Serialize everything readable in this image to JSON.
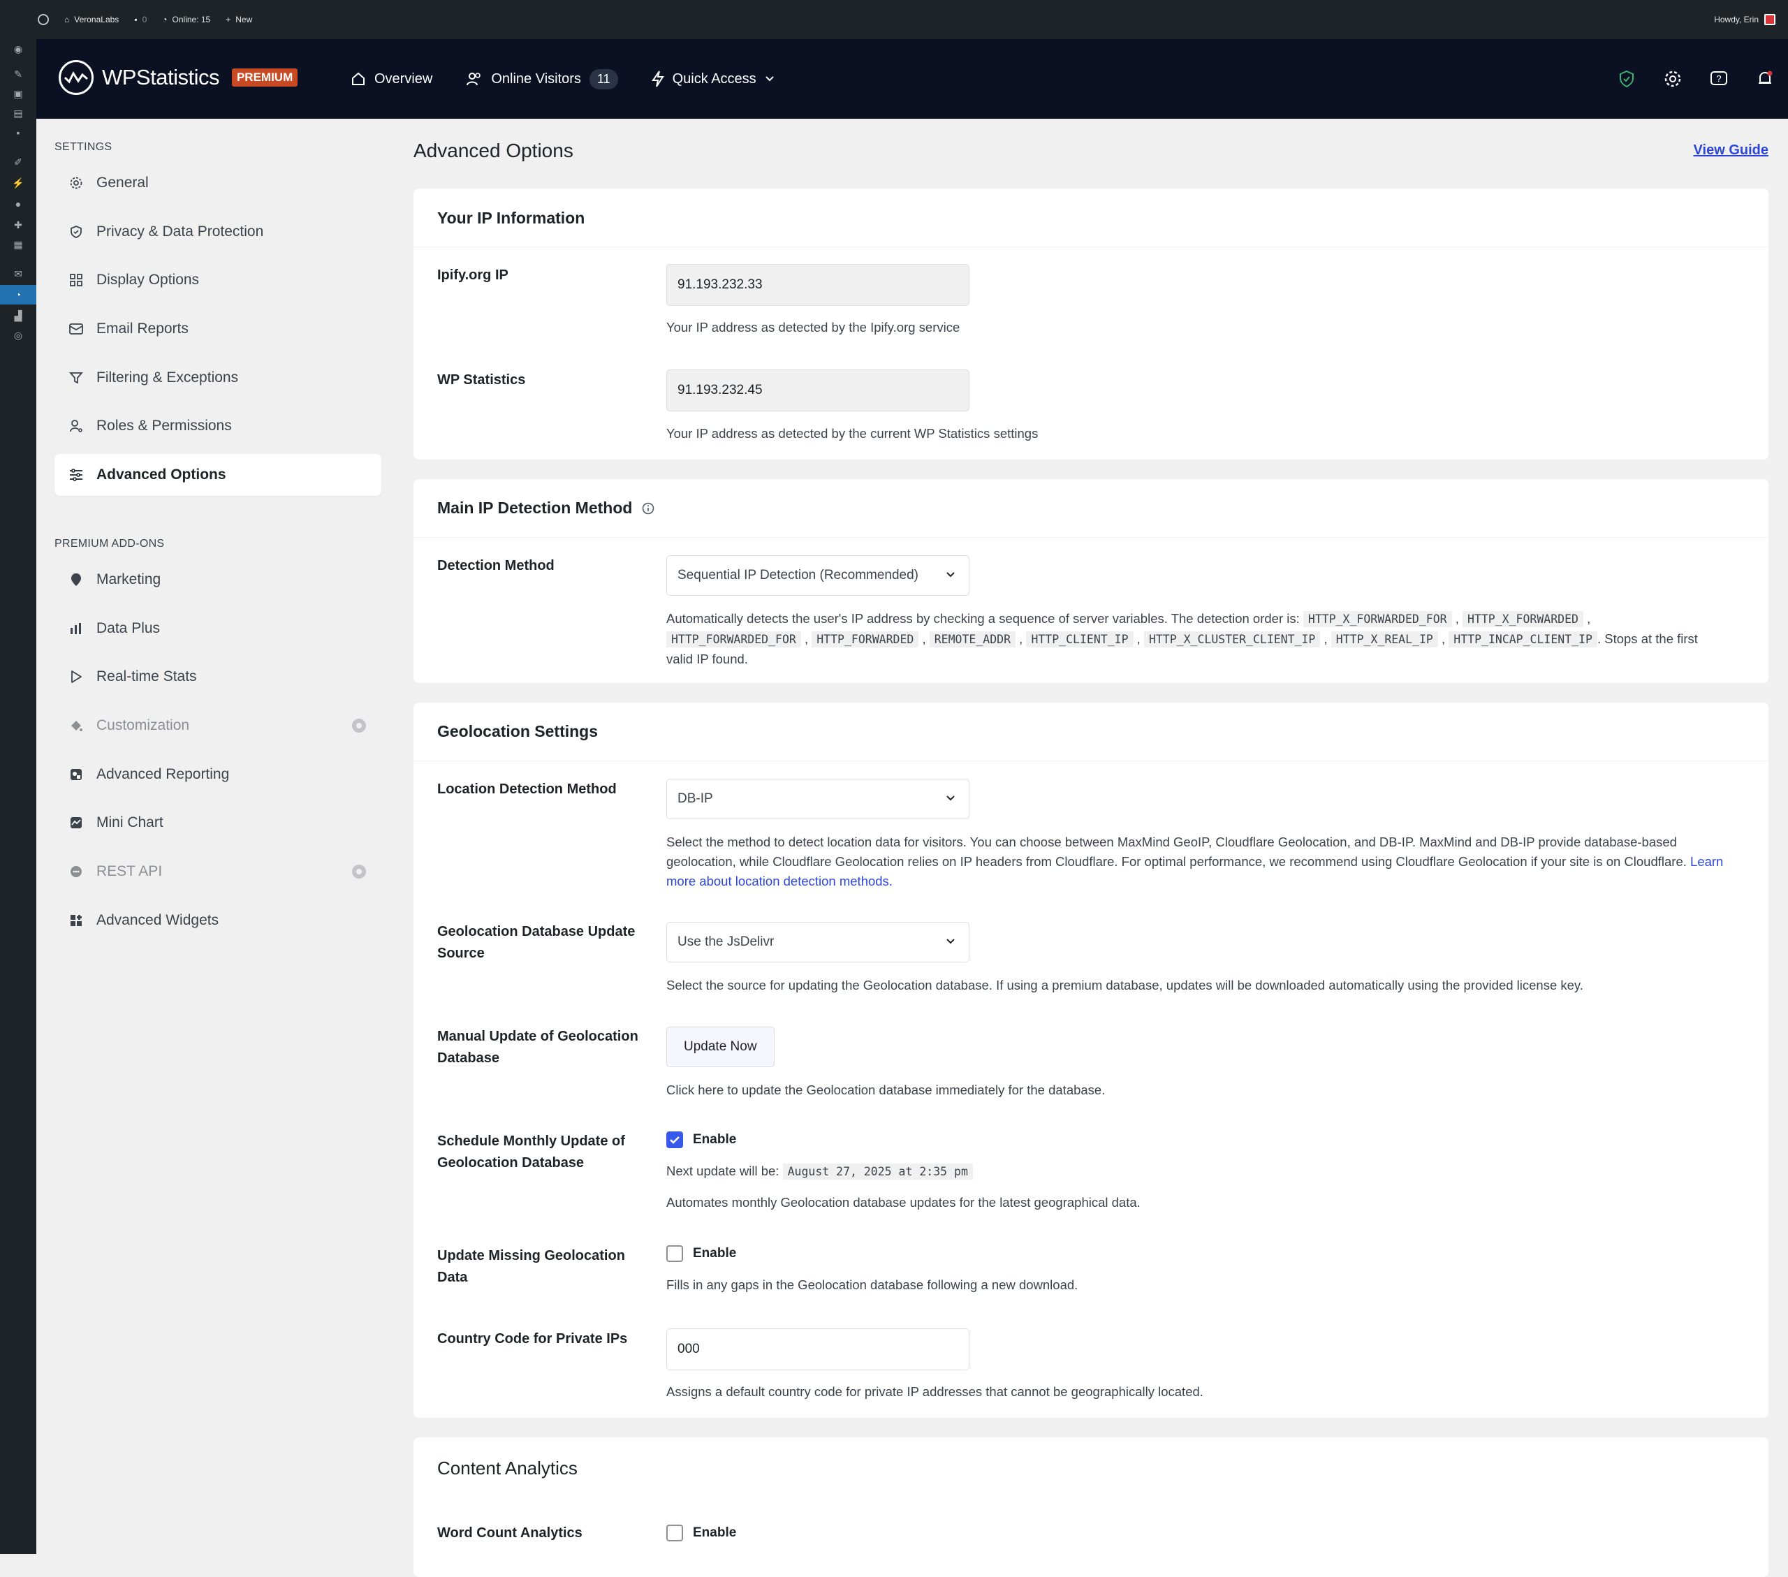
{
  "adminbar": {
    "site_name": "VeronaLabs",
    "comments_count": "0",
    "online": "Online: 15",
    "new": "New",
    "howdy": "Howdy, Erin"
  },
  "header": {
    "logo_text": "WPStatistics",
    "premium_badge": "PREMIUM",
    "nav": {
      "overview": "Overview",
      "online_visitors": "Online Visitors",
      "online_visitors_count": "11",
      "quick_access": "Quick Access"
    }
  },
  "sidebar": {
    "settings_heading": "SETTINGS",
    "settings_items": [
      {
        "label": "General"
      },
      {
        "label": "Privacy & Data Protection"
      },
      {
        "label": "Display Options"
      },
      {
        "label": "Email Reports"
      },
      {
        "label": "Filtering & Exceptions"
      },
      {
        "label": "Roles & Permissions"
      },
      {
        "label": "Advanced Options"
      }
    ],
    "addons_heading": "PREMIUM ADD-ONS",
    "addon_items": [
      {
        "label": "Marketing"
      },
      {
        "label": "Data Plus"
      },
      {
        "label": "Real-time Stats"
      },
      {
        "label": "Customization"
      },
      {
        "label": "Advanced Reporting"
      },
      {
        "label": "Mini Chart"
      },
      {
        "label": "REST API"
      },
      {
        "label": "Advanced Widgets"
      }
    ]
  },
  "page": {
    "title": "Advanced Options",
    "view_guide": "View Guide"
  },
  "ip_info": {
    "title": "Your IP Information",
    "ipify_label": "Ipify.org IP",
    "ipify_value": "91.193.232.33",
    "ipify_desc": "Your IP address as detected by the Ipify.org service",
    "wps_label": "WP Statistics",
    "wps_value": "91.193.232.45",
    "wps_desc": "Your IP address as detected by the current WP Statistics settings"
  },
  "ip_detection": {
    "title": "Main IP Detection Method",
    "method_label": "Detection Method",
    "method_value": "Sequential IP Detection (Recommended)",
    "desc_intro": "Automatically detects the user's IP address by checking a sequence of server variables. The detection order is:",
    "vars": [
      "HTTP_X_FORWARDED_FOR",
      "HTTP_X_FORWARDED",
      "HTTP_FORWARDED_FOR",
      "HTTP_FORWARDED",
      "REMOTE_ADDR",
      "HTTP_CLIENT_IP",
      "HTTP_X_CLUSTER_CLIENT_IP",
      "HTTP_X_REAL_IP",
      "HTTP_INCAP_CLIENT_IP"
    ],
    "desc_outro": ". Stops at the first valid IP found."
  },
  "geolocation": {
    "title": "Geolocation Settings",
    "location_label": "Location Detection Method",
    "location_value": "DB-IP",
    "location_desc": "Select the method to detect location data for visitors. You can choose between MaxMind GeoIP, Cloudflare Geolocation, and DB-IP. MaxMind and DB-IP provide database-based geolocation, while Cloudflare Geolocation relies on IP headers from Cloudflare. For optimal performance, we recommend using Cloudflare Geolocation if your site is on Cloudflare.",
    "location_link": "Learn more about location detection methods.",
    "source_label": "Geolocation Database Update Source",
    "source_value": "Use the JsDelivr",
    "source_desc": "Select the source for updating the Geolocation database. If using a premium database, updates will be downloaded automatically using the provided license key.",
    "manual_label": "Manual Update of Geolocation Database",
    "manual_button": "Update Now",
    "manual_desc": "Click here to update the Geolocation database immediately for the database.",
    "schedule_label": "Schedule Monthly Update of Geolocation Database",
    "schedule_enable": "Enable",
    "schedule_checked": true,
    "next_update_label": "Next update will be:",
    "next_update_value": "August 27, 2025 at 2:35 pm",
    "schedule_desc": "Automates monthly Geolocation database updates for the latest geographical data.",
    "missing_label": "Update Missing Geolocation Data",
    "missing_enable": "Enable",
    "missing_checked": false,
    "missing_desc": "Fills in any gaps in the Geolocation database following a new download.",
    "country_label": "Country Code for Private IPs",
    "country_value": "000",
    "country_desc": "Assigns a default country code for private IP addresses that cannot be geographically located."
  },
  "content_analytics": {
    "title": "Content Analytics",
    "word_count_label": "Word Count Analytics",
    "word_count_enable": "Enable",
    "word_count_checked": false
  },
  "colors": {
    "header_bg": "#0b1023",
    "accent": "#3858e9",
    "link": "#2b46d8",
    "premium": "#c74a24"
  }
}
